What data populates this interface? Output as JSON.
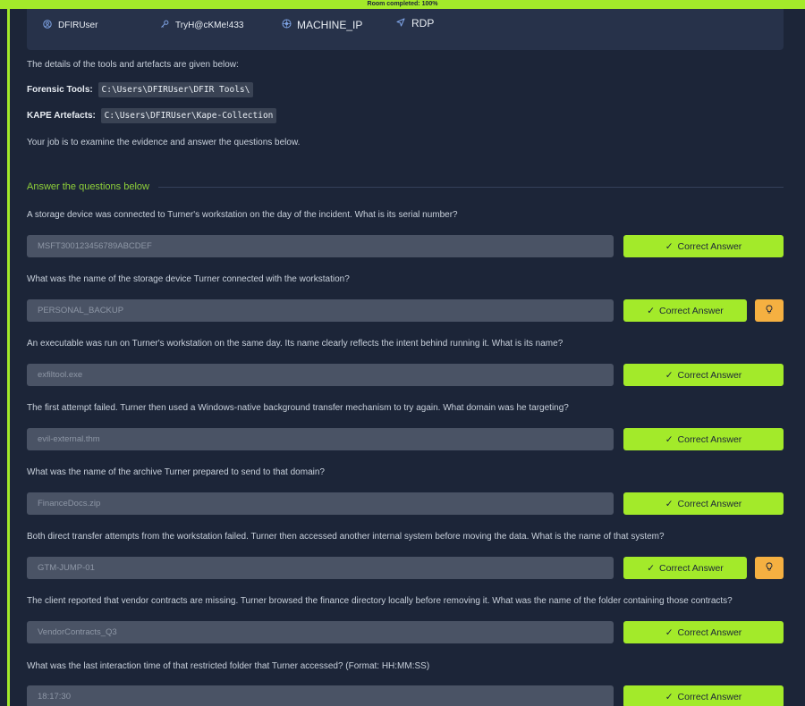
{
  "progress": {
    "label": "Room completed: 100%",
    "value": 100
  },
  "credentials": [
    {
      "label": "Username",
      "value": "DFIRUser",
      "icon": "user-icon"
    },
    {
      "label": "Password",
      "value": "TryH@cKMe!433",
      "icon": "key-icon"
    },
    {
      "label": "IP Address",
      "value": "MACHINE_IP",
      "icon": "network-icon"
    },
    {
      "label": "Connection via",
      "value": "RDP",
      "icon": "send-icon"
    }
  ],
  "intro": {
    "details": "The details of the tools and artefacts are given below:",
    "forensic_label": "Forensic Tools:",
    "forensic_path": "C:\\Users\\DFIRUser\\DFIR Tools\\",
    "kape_label": "KAPE Artefacts:",
    "kape_path": "C:\\Users\\DFIRUser\\Kape-Collection",
    "job": "Your job is to examine the evidence and answer the questions below."
  },
  "section_title": "Answer the questions below",
  "button_label": "Correct Answer",
  "colors": {
    "accent": "#a3ea2a",
    "hint": "#f5b041",
    "background": "#1c2538"
  },
  "questions": [
    {
      "text": "A storage device was connected to Turner's workstation on the day of the incident. What is its serial number?",
      "answer": "MSFT300123456789ABCDEF",
      "hint": false
    },
    {
      "text": "What was the name of the storage device Turner connected with the workstation?",
      "answer": "PERSONAL_BACKUP",
      "hint": true
    },
    {
      "text": "An executable was run on Turner's workstation on the same day. Its name clearly reflects the intent behind running it. What is its name?",
      "answer": "exfiltool.exe",
      "hint": false
    },
    {
      "text": "The first attempt failed. Turner then used a Windows-native background transfer mechanism to try again. What domain was he targeting?",
      "answer": "evil-external.thm",
      "hint": false
    },
    {
      "text": "What was the name of the archive Turner prepared to send to that domain?",
      "answer": "FinanceDocs.zip",
      "hint": false
    },
    {
      "text": "Both direct transfer attempts from the workstation failed. Turner then accessed another internal system before moving the data. What is the name of that system?",
      "answer": "GTM-JUMP-01",
      "hint": true
    },
    {
      "text": "The client reported that vendor contracts are missing. Turner browsed the finance directory locally before removing it. What was the name of the folder containing those contracts?",
      "answer": "VendorContracts_Q3",
      "hint": false
    },
    {
      "text": "What was the last interaction time of that restricted folder that Turner accessed? (Format: HH:MM:SS)",
      "answer": "18:17:30",
      "hint": false
    }
  ]
}
